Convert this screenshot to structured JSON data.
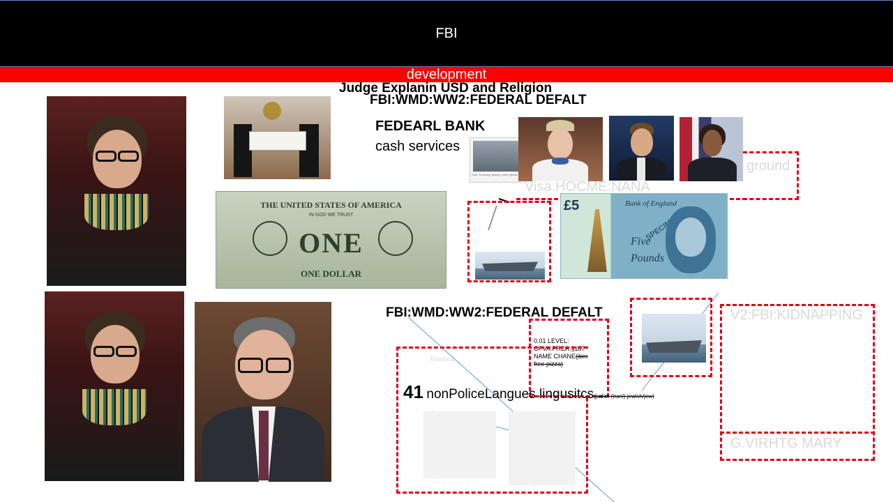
{
  "header": {
    "title": "FBI"
  },
  "banner": {
    "label": "development"
  },
  "texts": {
    "judge_line": "Judge Explanin USD and Religion",
    "wmd_top": "FBI:WMD:WW2:FEDERAL DEFALT",
    "bank_title": "FEDEARL BANK",
    "bank_sub": "cash services",
    "background_frag": "ground",
    "visa_line": "Visa:HOCME:NANA",
    "wmd_mid": "FBI:WMD:WW2:FEDERAL DEFALT",
    "level_1": "0.01 LEVEL:",
    "level_2": "CPVA.PREA.§187",
    "level_3": "NAME CHANE",
    "level_3_strike": "(ibm",
    "level_4_strike": "free pizza)",
    "count": "41",
    "languages": "nonPoliceLangues lingusitcs",
    "languages_note": "(juden (tranl) jewish/jew)",
    "kidnap_title": "V2:FBI:KIDNAPPING",
    "mary_line": "G.VIRHTG MARY",
    "faint_caption": "Rainbow...",
    "dollar_top": "THE UNITED STATES OF AMERICA",
    "dollar_center": "ONE",
    "dollar_bottom": "ONE DOLLAR",
    "trust": "IN GOD WE TRUST",
    "pound_bank": "Bank of England",
    "pound_five": "Five",
    "pound_pounds": "Pounds",
    "pound_value": "£5",
    "pound_specimen": "SPECIMEN",
    "cash_caption": "Coin, Currency, Money, Cash Operat..."
  },
  "colors": {
    "accent_red": "#ff0000",
    "dash_red": "#e0001a",
    "topbar": "#000000",
    "blue_line": "#5b9bd5"
  }
}
